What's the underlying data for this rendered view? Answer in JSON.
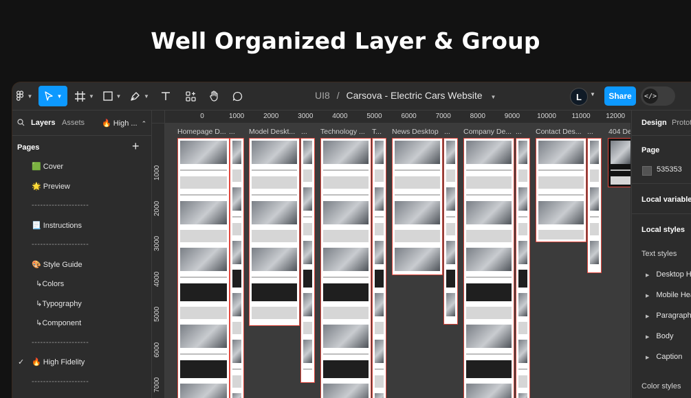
{
  "headline": "Well Organized Layer & Group",
  "toolbar": {
    "file_path": {
      "team": "UI8",
      "separator": "/",
      "file_name": "Carsova - Electric Cars Website"
    },
    "avatar_letter": "L",
    "share_label": "Share",
    "dev_mode_icon": "</>"
  },
  "left_panel": {
    "tabs": {
      "layers": "Layers",
      "assets": "Assets",
      "page_selector": "🔥 High ..."
    },
    "pages_header": "Pages",
    "pages": [
      {
        "label": "🟩 Cover",
        "checked": false
      },
      {
        "label": "🌟 Preview",
        "checked": false
      },
      {
        "label": "--------------------",
        "checked": false
      },
      {
        "label": "📃 Instructions",
        "checked": false
      },
      {
        "label": "--------------------",
        "checked": false
      },
      {
        "label": "🎨 Style Guide",
        "checked": false
      },
      {
        "label": "  ↳Colors",
        "checked": false
      },
      {
        "label": "  ↳Typography",
        "checked": false
      },
      {
        "label": "  ↳Component",
        "checked": false
      },
      {
        "label": "--------------------",
        "checked": false
      },
      {
        "label": "🔥 High Fidelity",
        "checked": true
      },
      {
        "label": "--------------------",
        "checked": false
      }
    ],
    "check_mark": "✓"
  },
  "canvas": {
    "ruler_top": [
      "0",
      "1000",
      "2000",
      "3000",
      "4000",
      "5000",
      "6000",
      "7000",
      "8000",
      "9000",
      "10000",
      "11000",
      "12000"
    ],
    "ruler_left": [
      "1000",
      "2000",
      "3000",
      "4000",
      "5000",
      "6000",
      "7000"
    ],
    "frame_labels": [
      "Homepage D...",
      "...",
      "Model Deskt...",
      "...",
      "Technology ...",
      "T...",
      "News Desktop",
      "...",
      "Company De...",
      "...",
      "Contact Des...",
      "...",
      "404 De"
    ]
  },
  "right_panel": {
    "tabs": {
      "design": "Design",
      "prototype": "Protot"
    },
    "page_section": "Page",
    "page_color": "535353",
    "local_variables": "Local variables",
    "local_styles": "Local styles",
    "text_styles_header": "Text styles",
    "text_styles": [
      "Desktop He",
      "Mobile Hea",
      "Paragraph",
      "Body",
      "Caption"
    ],
    "color_styles_header": "Color styles"
  },
  "colors": {
    "accent_blue": "#0d99ff",
    "panel": "#2c2c2c",
    "canvas_bg": "#535353",
    "frame_outline": "#e0463c"
  }
}
